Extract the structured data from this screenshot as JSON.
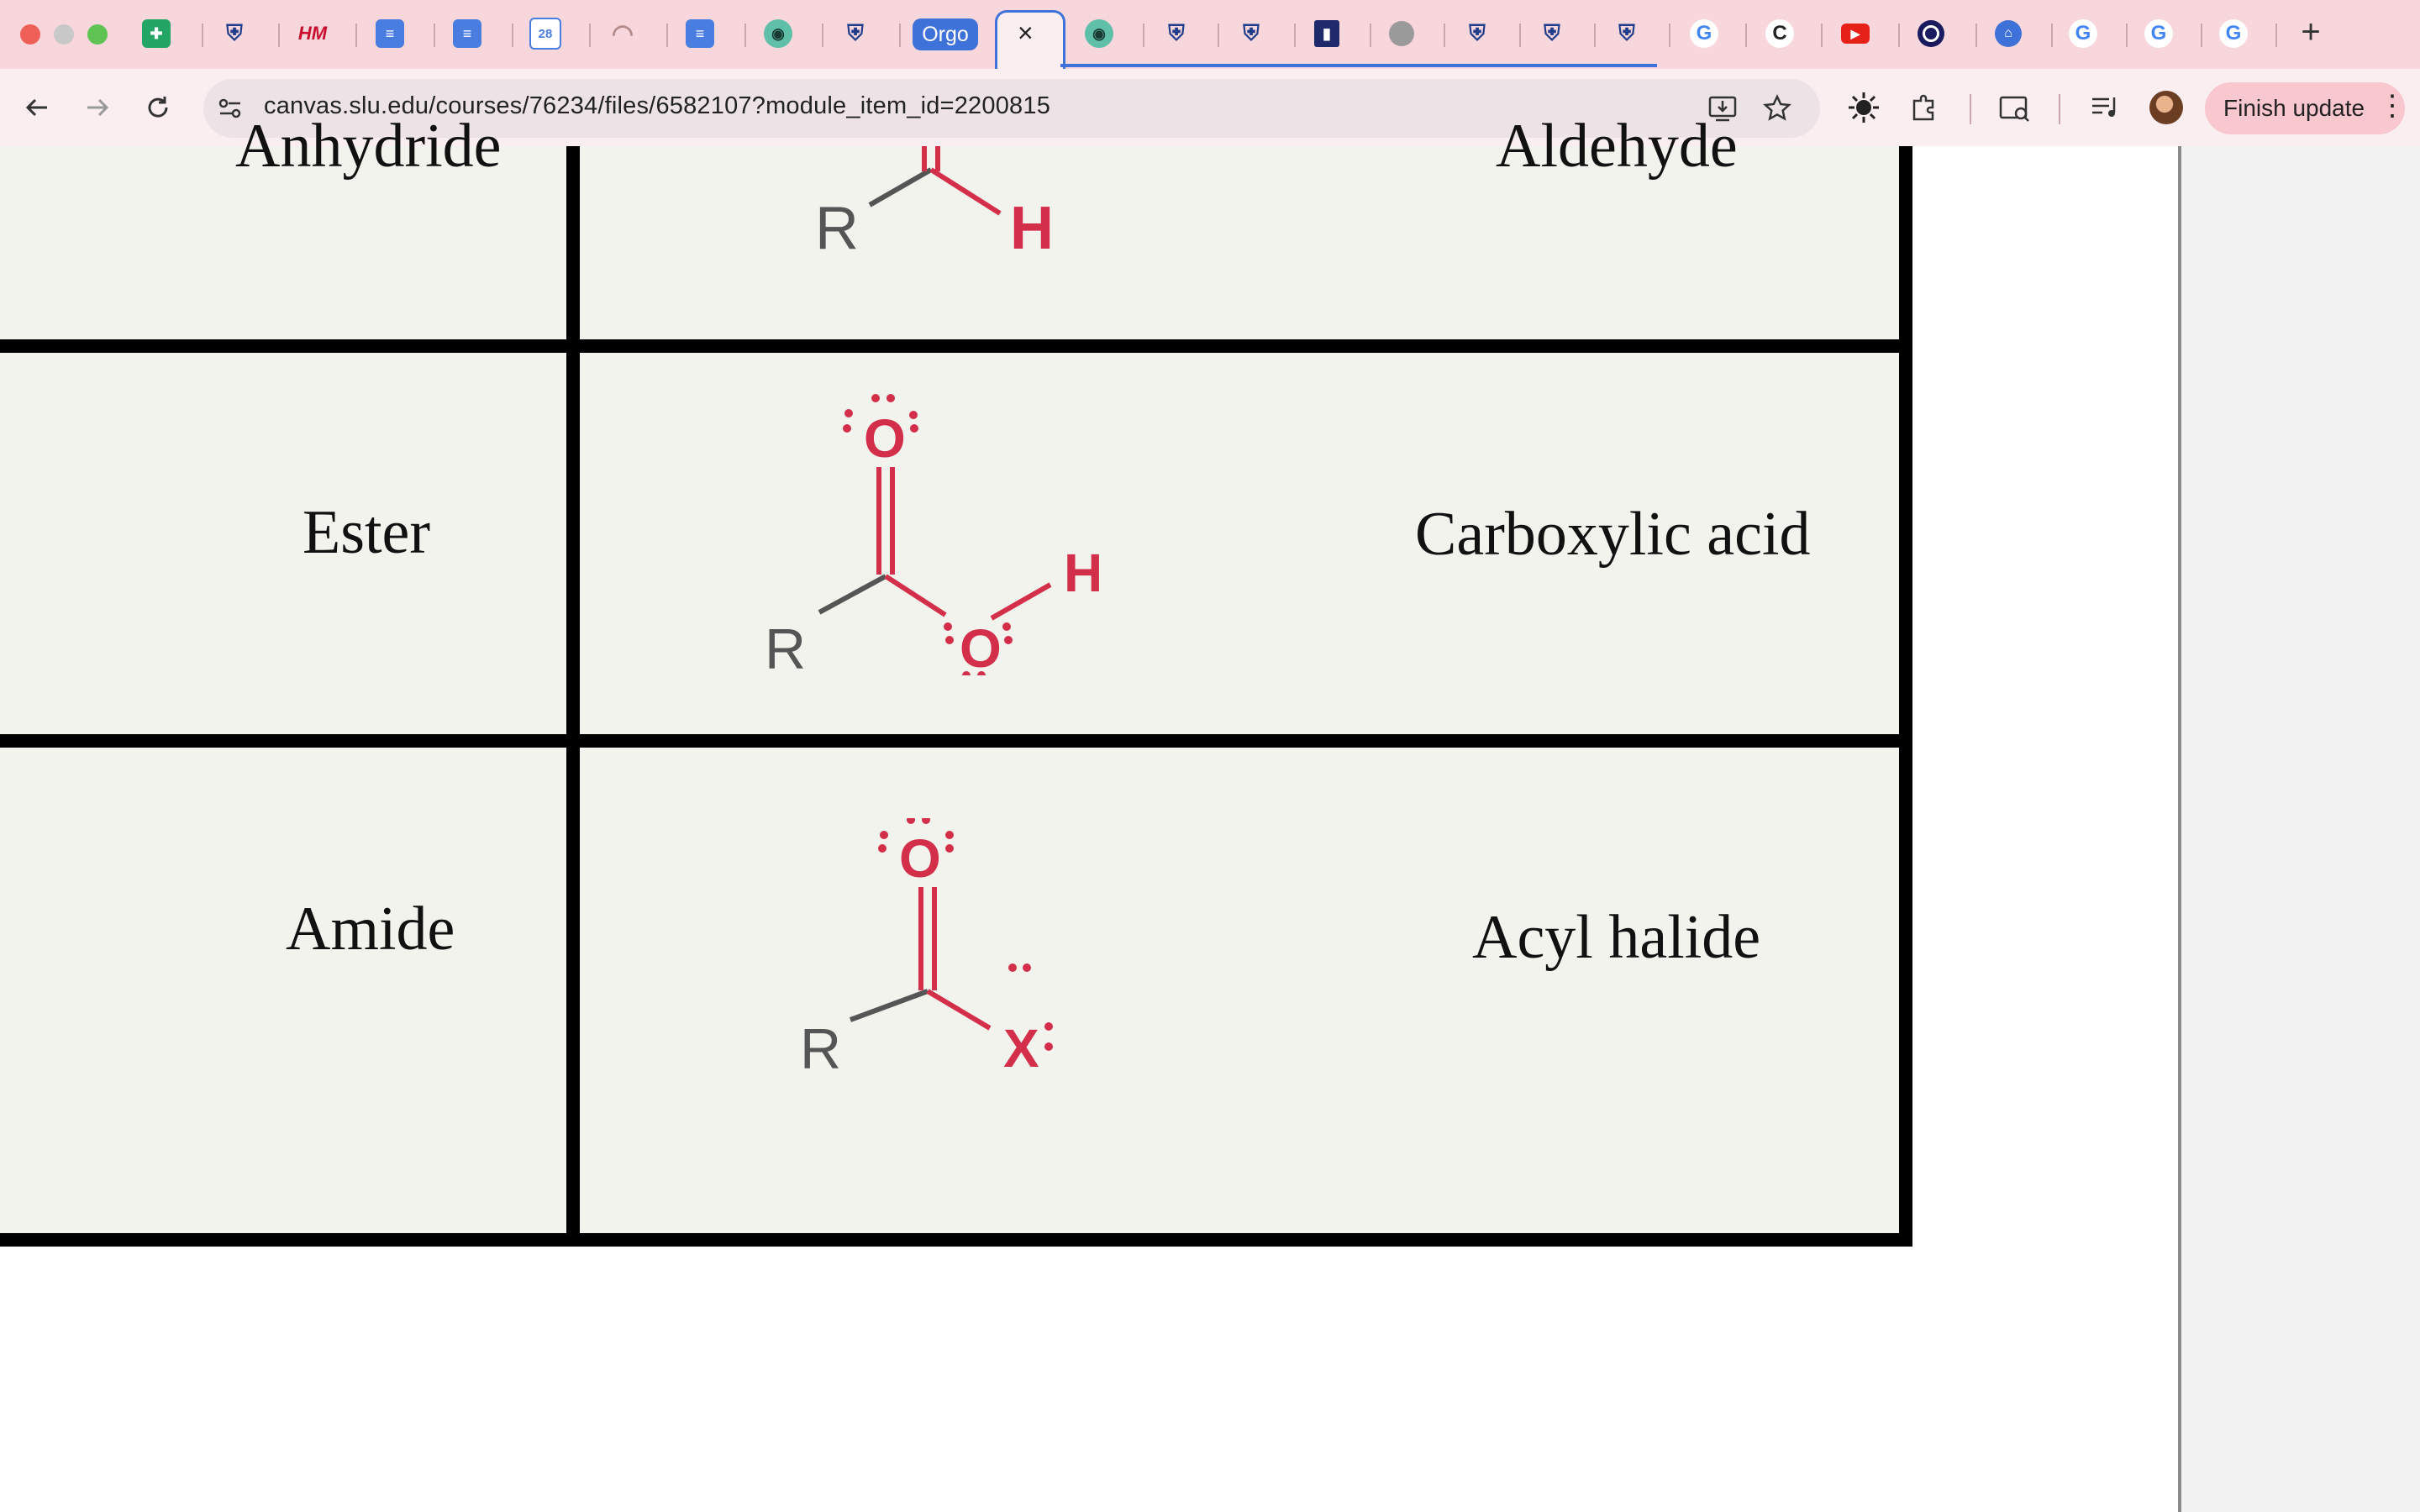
{
  "browser": {
    "url": "canvas.slu.edu/courses/76234/files/6582107?module_item_id=2200815",
    "finish_update_label": "Finish update",
    "tabs": [
      {
        "icon": "sheets-icon"
      },
      {
        "icon": "slu-shield-icon"
      },
      {
        "icon": "hm-icon",
        "text": "HM"
      },
      {
        "icon": "docs-icon"
      },
      {
        "icon": "docs-icon"
      },
      {
        "icon": "calendar-icon",
        "text": "28"
      },
      {
        "icon": "arc-icon"
      },
      {
        "icon": "docs-icon"
      },
      {
        "icon": "frog-icon"
      },
      {
        "icon": "slu-shield-icon"
      },
      {
        "icon": "orgo-group-label",
        "text": "Orgo"
      },
      {
        "icon": "active-tab-close",
        "text": "×"
      },
      {
        "icon": "frog-icon"
      },
      {
        "icon": "slu-shield-icon"
      },
      {
        "icon": "slu-shield-icon"
      },
      {
        "icon": "bookmark-icon"
      },
      {
        "icon": "globe-icon"
      },
      {
        "icon": "slu-shield-icon"
      },
      {
        "icon": "slu-shield-icon"
      },
      {
        "icon": "slu-shield-icon"
      },
      {
        "icon": "google-icon",
        "text": "G"
      },
      {
        "icon": "chegg-icon",
        "text": "C"
      },
      {
        "icon": "youtube-icon"
      },
      {
        "icon": "record-icon"
      },
      {
        "icon": "bank-icon"
      },
      {
        "icon": "google-icon",
        "text": "G"
      },
      {
        "icon": "google-icon",
        "text": "G"
      },
      {
        "icon": "google-icon",
        "text": "G"
      }
    ],
    "new_tab_label": "+"
  },
  "table": {
    "rows": [
      {
        "left": "Anhydride",
        "right": "Aldehyde",
        "structure": {
          "R": "R",
          "X": "H"
        }
      },
      {
        "left": "Ester",
        "right": "Carboxylic acid",
        "structure": {
          "R": "R",
          "O": "O",
          "O2": "O",
          "H": "H"
        }
      },
      {
        "left": "Amide",
        "right": "Acyl halide",
        "structure": {
          "R": "R",
          "O": "O",
          "X": "X"
        }
      }
    ]
  },
  "colors": {
    "tabbar": "#f7d7db",
    "toolbar": "#fbeef0",
    "accent": "#4a7de0",
    "chem_red": "#d32f4a"
  }
}
